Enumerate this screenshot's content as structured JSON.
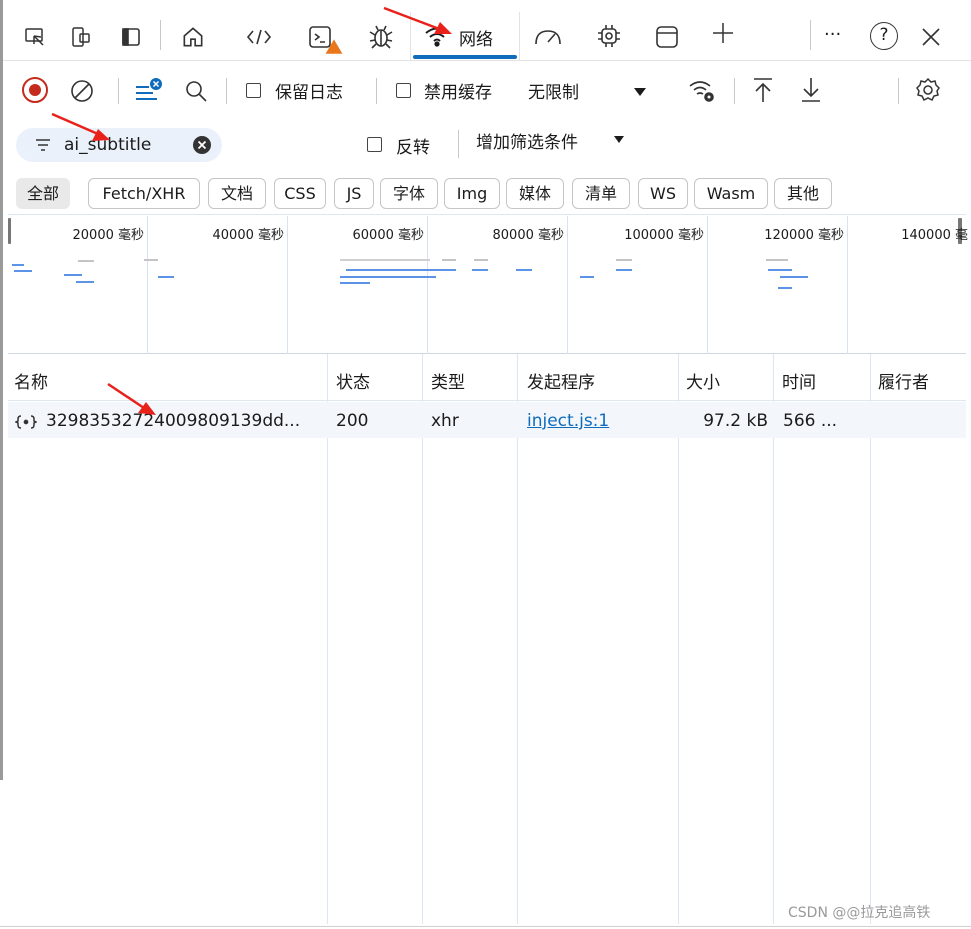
{
  "tabs": {
    "network_label": "网络",
    "more_label": "···",
    "help_label": "?"
  },
  "toolbar": {
    "preserve_log_label": "保留日志",
    "disable_cache_label": "禁用缓存",
    "throttle_label": "无限制"
  },
  "filter": {
    "value": "ai_subtitle",
    "invert_label": "反转",
    "more_filters_label": "增加筛选条件"
  },
  "type_filters": [
    "全部",
    "Fetch/XHR",
    "文档",
    "CSS",
    "JS",
    "字体",
    "Img",
    "媒体",
    "清单",
    "WS",
    "Wasm",
    "其他"
  ],
  "overview": {
    "ticks": [
      "20000 毫秒",
      "40000 毫秒",
      "60000 毫秒",
      "80000 毫秒",
      "100000 毫秒",
      "120000 毫秒",
      "140000 毫"
    ]
  },
  "table": {
    "columns": [
      "名称",
      "状态",
      "类型",
      "发起程序",
      "大小",
      "时间",
      "履行者"
    ],
    "rows": [
      {
        "name": "32983532724009809139dd...",
        "status": "200",
        "type": "xhr",
        "initiator": "inject.js:1",
        "size": "97.2 kB",
        "time": "566 ..."
      }
    ]
  },
  "watermark": "CSDN @@拉克追高铁",
  "colors": {
    "accent": "#0f6cbd",
    "record_red": "#c42b1c",
    "annotation_arrow": "#e8221b",
    "waterfall_bar": "#5b93e6"
  }
}
